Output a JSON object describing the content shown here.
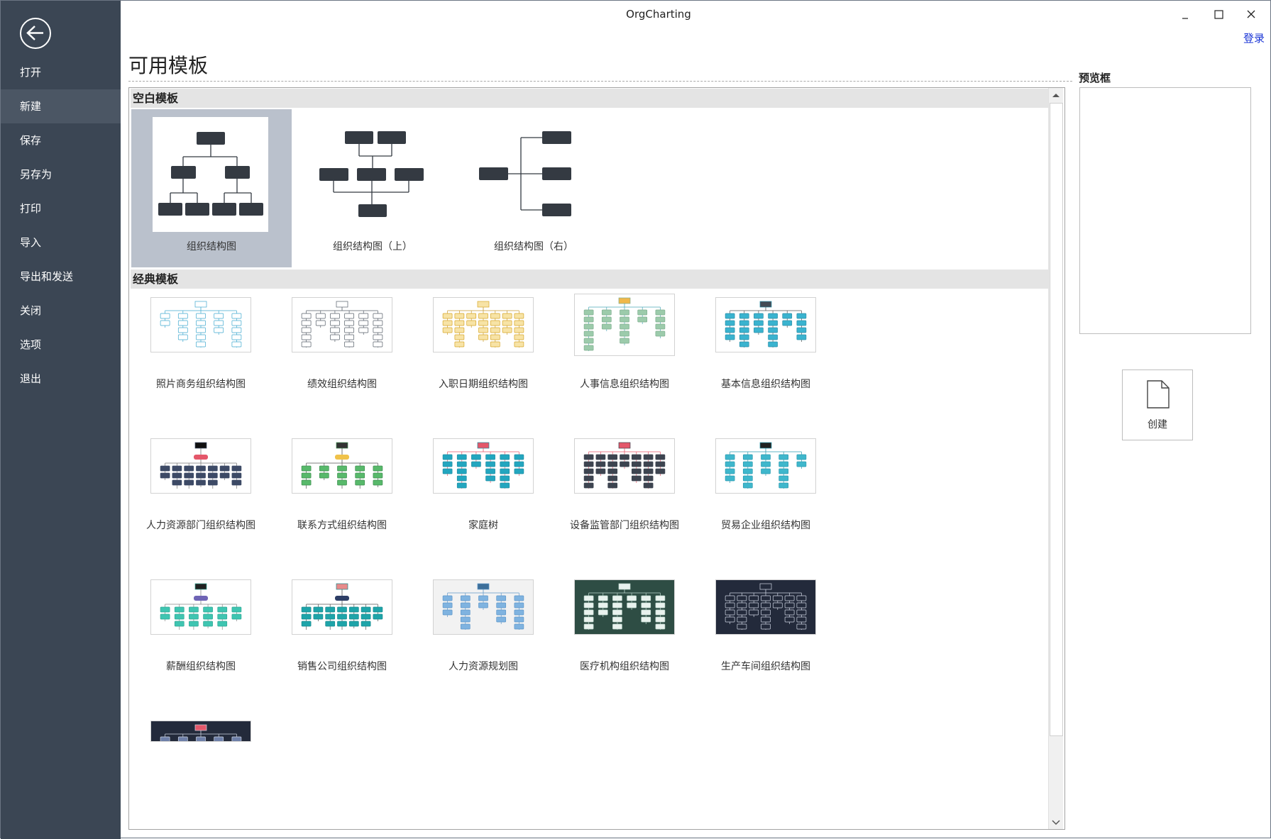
{
  "app": {
    "title": "OrgCharting",
    "login": "登录"
  },
  "sidebar": {
    "items": [
      {
        "label": "打开",
        "name": "sidebar-item-open"
      },
      {
        "label": "新建",
        "name": "sidebar-item-new"
      },
      {
        "label": "保存",
        "name": "sidebar-item-save"
      },
      {
        "label": "另存为",
        "name": "sidebar-item-save-as"
      },
      {
        "label": "打印",
        "name": "sidebar-item-print"
      },
      {
        "label": "导入",
        "name": "sidebar-item-import"
      },
      {
        "label": "导出和发送",
        "name": "sidebar-item-export-send"
      },
      {
        "label": "关闭",
        "name": "sidebar-item-close"
      },
      {
        "label": "选项",
        "name": "sidebar-item-options"
      },
      {
        "label": "退出",
        "name": "sidebar-item-exit"
      }
    ],
    "active": "新建"
  },
  "main": {
    "heading": "可用模板",
    "blank_section": {
      "title": "空白模板",
      "templates": [
        {
          "label": "组织结构图",
          "selected": true
        },
        {
          "label": "组织结构图（上）",
          "selected": false
        },
        {
          "label": "组织结构图（右）",
          "selected": false
        }
      ]
    },
    "classic_section": {
      "title": "经典模板",
      "templates": [
        {
          "label": "照片商务组织结构图",
          "style": "light-blue"
        },
        {
          "label": "绩效组织结构图",
          "style": "gray"
        },
        {
          "label": "入职日期组织结构图",
          "style": "yellow"
        },
        {
          "label": "人事信息组织结构图",
          "style": "green"
        },
        {
          "label": "基本信息组织结构图",
          "style": "teal-dark"
        },
        {
          "label": "人力资源部门组织结构图",
          "style": "red-navy"
        },
        {
          "label": "联系方式组织结构图",
          "style": "green-dark"
        },
        {
          "label": "家庭树",
          "style": "pink-teal"
        },
        {
          "label": "设备监管部门组织结构图",
          "style": "red-dark"
        },
        {
          "label": "贸易企业组织结构图",
          "style": "cyan"
        },
        {
          "label": "薪酬组织结构图",
          "style": "purple-teal"
        },
        {
          "label": "销售公司组织结构图",
          "style": "navy-teal"
        },
        {
          "label": "人力资源规划图",
          "style": "blue-pattern"
        },
        {
          "label": "医疗机构组织结构图",
          "style": "dark-green-bg"
        },
        {
          "label": "生产车间组织结构图",
          "style": "dark-navy-bg"
        },
        {
          "label": "",
          "style": "dark-navy-partial"
        }
      ]
    }
  },
  "preview": {
    "label": "预览框",
    "create_label": "创建"
  },
  "colors": {
    "sidebar": "#3b4654",
    "selected_tile": "#bac1cc",
    "login_link": "#1a35d6"
  }
}
